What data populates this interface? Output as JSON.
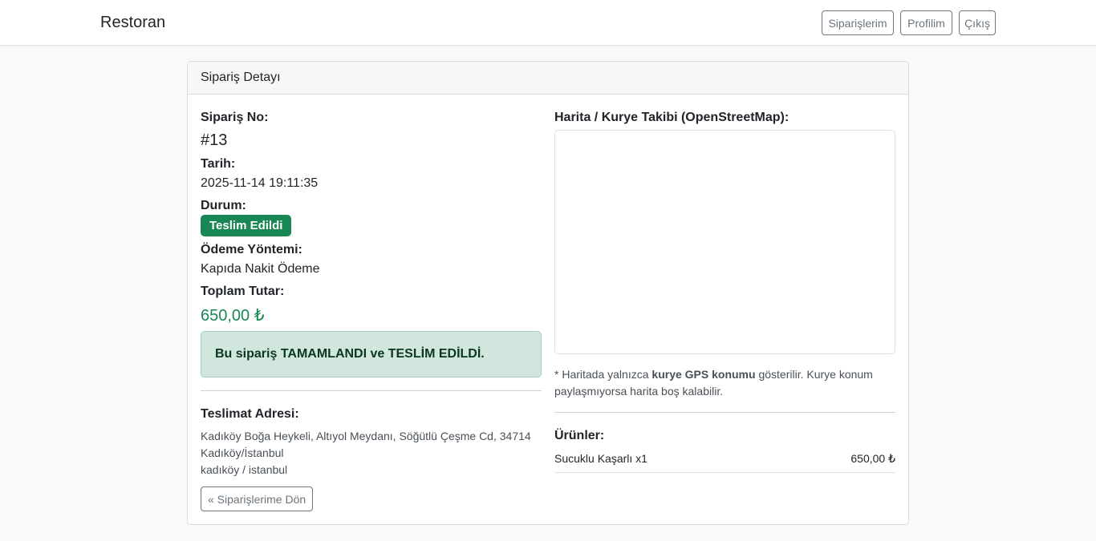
{
  "navbar": {
    "brand": "Restoran",
    "buttons": [
      "Siparişlerim",
      "Profilim",
      "Çıkış"
    ]
  },
  "card": {
    "header": "Sipariş Detayı",
    "order_no_label": "Sipariş No:",
    "order_no": "#13",
    "date_label": "Tarih:",
    "date": "2025-11-14 19:11:35",
    "status_label": "Durum:",
    "status": "Teslim Edildi",
    "payment_label": "Ödeme Yöntemi:",
    "payment": "Kapıda Nakit Ödeme",
    "total_label": "Toplam Tutar:",
    "total": "650,00 ₺",
    "alert": {
      "prefix": "Bu sipariş ",
      "completed": "TAMAMLANDI",
      "mid": " ve ",
      "delivered": "TESLİM EDİLDİ",
      "suffix": "."
    },
    "address_label": "Teslimat Adresi:",
    "address_lines": [
      "Kadıköy Boğa Heykeli, Altıyol Meydanı, Söğütlü Çeşme Cd, 34714",
      "Kadıköy/İstanbul",
      "kadıköy / istanbul"
    ],
    "back_button": "« Siparişlerime Dön",
    "map_label": "Harita / Kurye Takibi (OpenStreetMap):",
    "map_note": {
      "prefix": "* Haritada yalnızca ",
      "bold": "kurye GPS konumu",
      "suffix": " gösterilir. Kurye konum paylaşmıyorsa harita boş kalabilir."
    },
    "items_label": "Ürünler:",
    "items": [
      {
        "name": "Sucuklu Kaşarlı x1",
        "price": "650,00 ₺"
      }
    ]
  },
  "colors": {
    "success": "#198754",
    "alert_bg": "#d1e7dd",
    "secondary": "#6c757d"
  }
}
